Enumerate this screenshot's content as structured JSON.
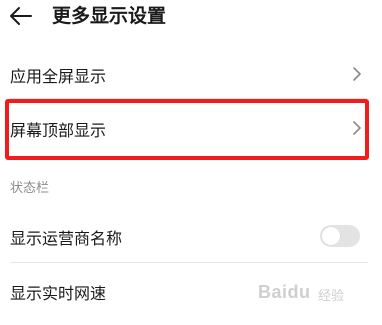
{
  "header": {
    "title": "更多显示设置",
    "back_icon": "back-arrow-icon"
  },
  "rows": [
    {
      "label": "应用全屏显示",
      "control": "chevron-right-icon"
    },
    {
      "label": "屏幕顶部显示",
      "control": "chevron-right-icon",
      "highlighted": true
    },
    {
      "label": "显示运营商名称",
      "control": "toggle",
      "toggle_on": false
    },
    {
      "label": "显示实时网速",
      "control": "none"
    }
  ],
  "section": {
    "label": "状态栏"
  },
  "watermark": {
    "text": "Baidu",
    "sub": "经验"
  },
  "colors": {
    "highlight": "#f21c1c",
    "toggle_off": "#e3e3e3",
    "text": "#1a1a1a",
    "section_text": "#8c8c8c"
  }
}
